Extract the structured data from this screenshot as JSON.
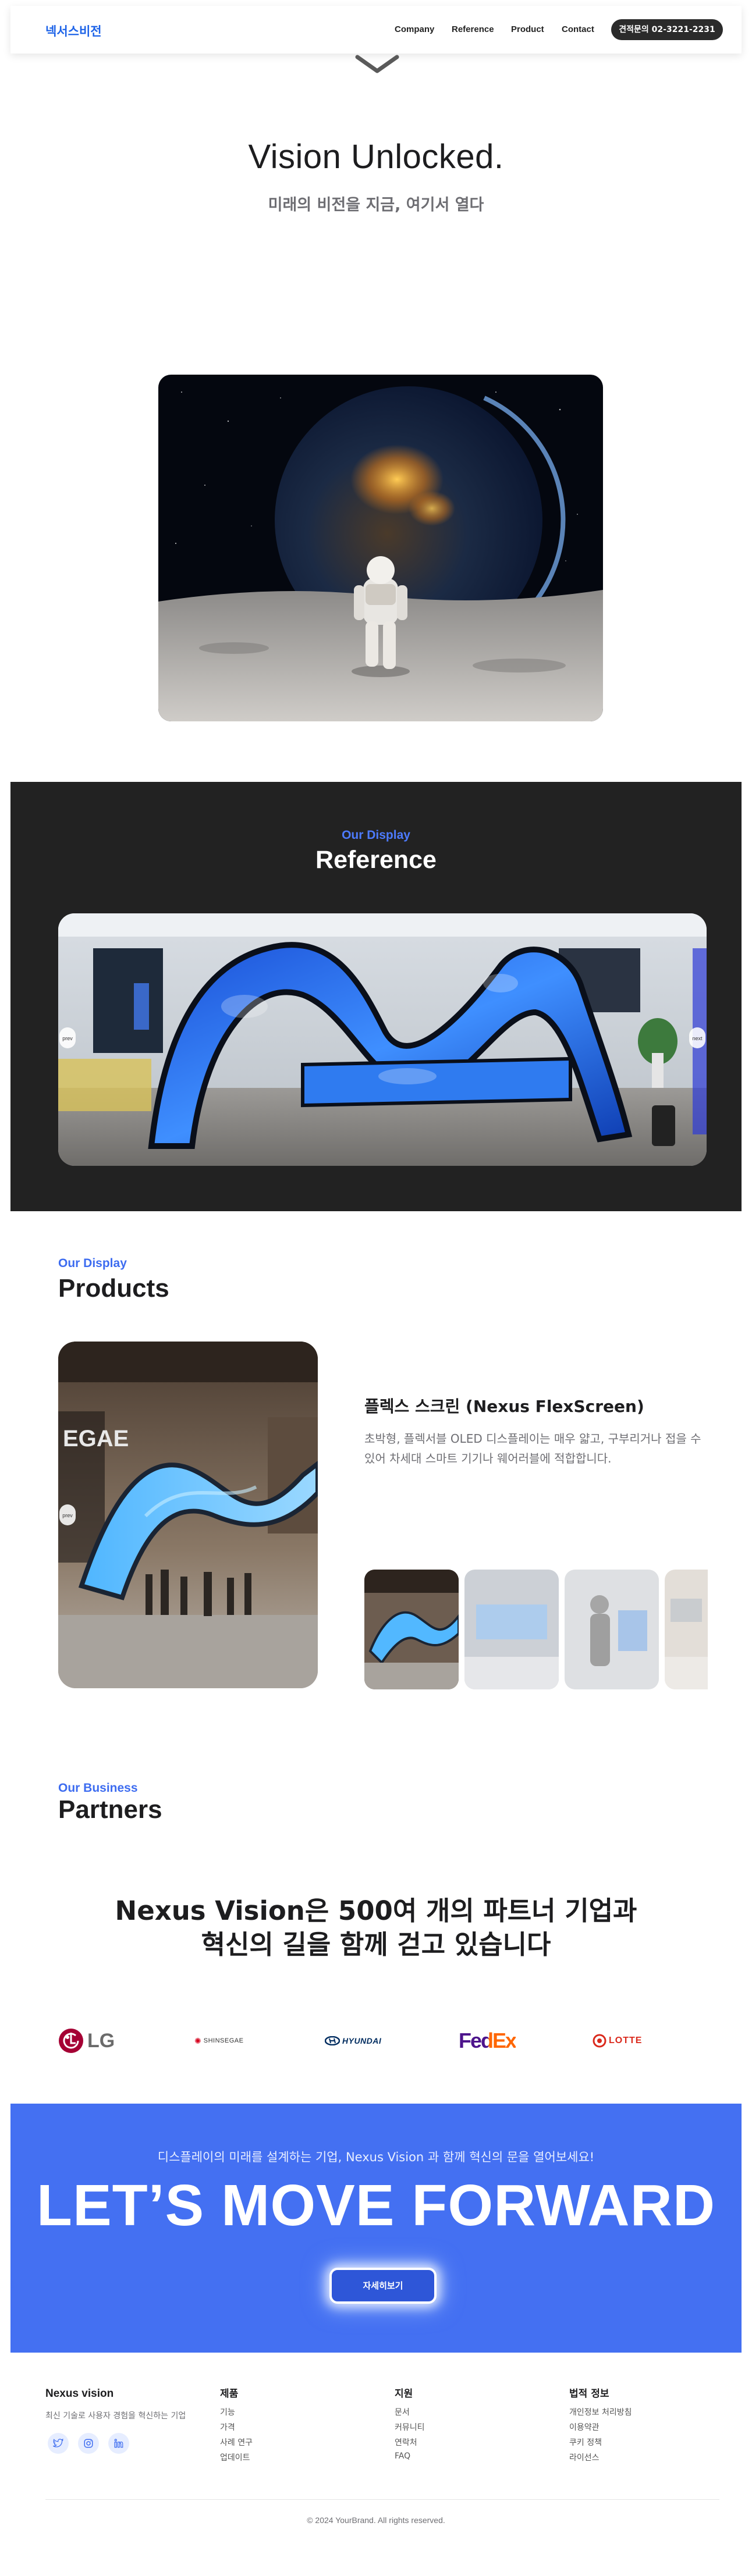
{
  "nav": {
    "logo": "넥서스비전",
    "links": [
      "Company",
      "Reference",
      "Product",
      "Contact"
    ],
    "cta": "견적문의 02-3221-2231"
  },
  "hero": {
    "title": "Vision Unlocked.",
    "subtitle": "미래의 비전을 지금, 여기서 열다"
  },
  "reference": {
    "eyebrow": "Our Display",
    "title": "Reference",
    "prev_label": "prev",
    "next_label": "next"
  },
  "products": {
    "eyebrow": "Our Display",
    "title": "Products",
    "prev_label": "prev",
    "name": "플렉스 스크린 (Nexus FlexScreen)",
    "description": "초박형, 플렉서블 OLED 디스플레이는 매우 얇고, 구부리거나 접을 수 있어 차세대 스마트 기기나 웨어러블에 적합합니다."
  },
  "partners": {
    "eyebrow": "Our Business",
    "title": "Partners",
    "headline_line1": "Nexus Vision은 500여 개의 파트너 기업과",
    "headline_line2": "혁신의 길을 함께 걷고 있습니다",
    "logos": [
      "LG",
      "SHINSEGAE",
      "HYUNDAI",
      "FedEx",
      "LOTTE"
    ]
  },
  "cta": {
    "subtitle": "디스플레이의 미래를 설계하는 기업, Nexus Vision 과 함께 혁신의 문을 열어보세요!",
    "headline": "LET’S MOVE FORWARD",
    "button": "자세히보기"
  },
  "footer": {
    "brand": "Nexus vision",
    "tagline": "최신 기술로 사용자 경험을 혁신하는 기업",
    "columns": [
      {
        "title": "제품",
        "links": [
          "기능",
          "가격",
          "사례 연구",
          "업데이트"
        ]
      },
      {
        "title": "지원",
        "links": [
          "문서",
          "커뮤니티",
          "연락처",
          "FAQ"
        ]
      },
      {
        "title": "법적 정보",
        "links": [
          "개인정보 처리방침",
          "이용약관",
          "쿠키 정책",
          "라이선스"
        ]
      }
    ],
    "copyright": "© 2024 YourBrand. All rights reserved."
  },
  "colors": {
    "brand_blue": "#1d63e8",
    "accent_blue": "#4470f2",
    "dark_section": "#222222"
  },
  "icons": [
    "chevron-down-icon",
    "twitter-icon",
    "instagram-icon",
    "linkedin-icon"
  ]
}
